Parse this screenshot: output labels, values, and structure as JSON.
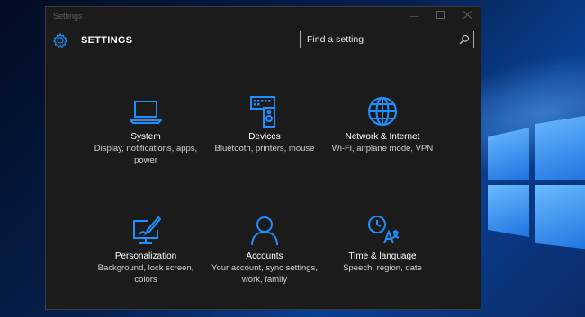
{
  "window": {
    "title": "Settings",
    "header_title": "SETTINGS"
  },
  "search": {
    "placeholder": "Find a setting"
  },
  "tiles": [
    {
      "label": "System",
      "desc": "Display, notifications, apps, power",
      "icon": "laptop-icon"
    },
    {
      "label": "Devices",
      "desc": "Bluetooth, printers, mouse",
      "icon": "devices-icon"
    },
    {
      "label": "Network & Internet",
      "desc": "Wi-Fi, airplane mode, VPN",
      "icon": "globe-icon"
    },
    {
      "label": "Personalization",
      "desc": "Background, lock screen, colors",
      "icon": "paintbrush-icon"
    },
    {
      "label": "Accounts",
      "desc": "Your account, sync settings, work, family",
      "icon": "person-icon"
    },
    {
      "label": "Time & language",
      "desc": "Speech, region, date",
      "icon": "time-language-icon"
    }
  ],
  "colors": {
    "accent": "#1e8fff",
    "window_bg": "#1b1b1b",
    "desktop_bg": "#0a3f8f"
  }
}
